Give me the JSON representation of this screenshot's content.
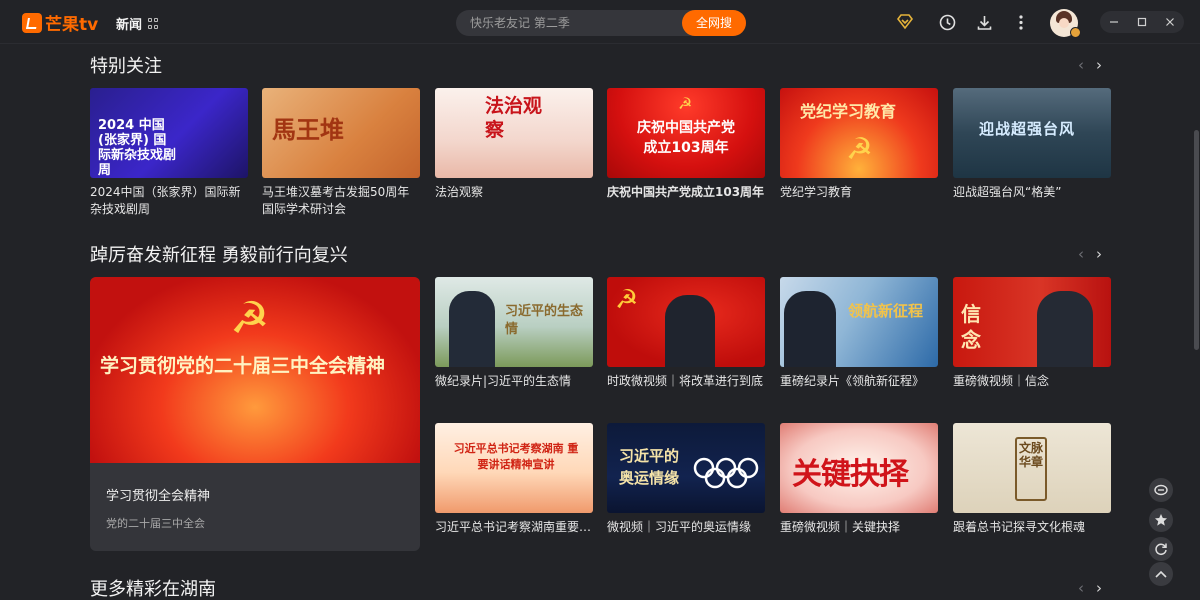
{
  "app": {
    "logo": "芒果tv",
    "channel": "新闻"
  },
  "search": {
    "placeholder": "快乐老友记 第二季",
    "button": "全网搜"
  },
  "toolbar_icons": [
    "vip-diamond-icon",
    "history-clock-icon",
    "download-icon",
    "more-vertical-icon"
  ],
  "window_controls": [
    "minimize",
    "maximize",
    "close"
  ],
  "colors": {
    "accent": "#ff6a00",
    "background": "#222327",
    "vip_gold": "#e5b33a"
  },
  "sections": [
    {
      "title": "特别关注",
      "cards": [
        {
          "caption": "2024中国（张家界）国际新杂技戏剧周",
          "thumb_text": "2024 中国(张家界) 国际新杂技戏剧周"
        },
        {
          "caption": "马王堆汉墓考古发掘50周年国际学术研讨会",
          "thumb_text": "馬王堆"
        },
        {
          "caption": "法治观察",
          "thumb_text": "法治观察"
        },
        {
          "caption": "庆祝中国共产党成立103周年",
          "thumb_text": "庆祝中国共产党 成立103周年"
        },
        {
          "caption": "党纪学习教育",
          "thumb_text": "党纪学习教育"
        },
        {
          "caption": "迎战超强台风“格美”",
          "thumb_text": "迎战超强台风"
        }
      ]
    },
    {
      "title": "踔厉奋发新征程 勇毅前行向复兴",
      "featured": {
        "title": "学习贯彻全会精神",
        "subtitle": "党的二十届三中全会",
        "thumb_text": "学习贯彻党的二十届三中全会精神"
      },
      "cards": [
        {
          "caption": "微纪录片|习近平的生态情",
          "thumb_text": "习近平的生态情"
        },
        {
          "caption": "时政微视频｜将改革进行到底",
          "thumb_text": ""
        },
        {
          "caption": "重磅纪录片《领航新征程》",
          "thumb_text": "领航新征程"
        },
        {
          "caption": "重磅微视频｜信念",
          "thumb_text": "信念"
        },
        {
          "caption": "习近平总书记考察湖南重要讲话精神",
          "thumb_text": "习近平总书记考察湖南 重要讲话精神宣讲"
        },
        {
          "caption": "微视频｜习近平的奥运情缘",
          "thumb_text": "习近平的奥运情缘"
        },
        {
          "caption": "重磅微视频｜关键抉择",
          "thumb_text": "关键抉择"
        },
        {
          "caption": "跟着总书记探寻文化根魂",
          "thumb_text": "文脉华章"
        }
      ]
    },
    {
      "title": "更多精彩在湖南"
    }
  ],
  "nav_arrows": {
    "prev": "‹",
    "next": "›"
  },
  "side_buttons": [
    "feedback-icon",
    "favorite-star-icon",
    "refresh-icon",
    "back-to-top-icon"
  ]
}
